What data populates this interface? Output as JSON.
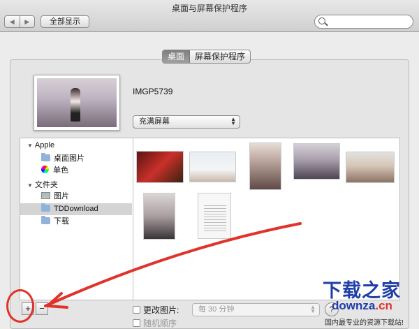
{
  "window": {
    "title": "桌面与屏幕保护程序"
  },
  "toolbar": {
    "back_icon": "◀",
    "forward_icon": "▶",
    "show_all": "全部显示",
    "search_placeholder": ""
  },
  "tabs": [
    {
      "label": "桌面",
      "active": true
    },
    {
      "label": "屏幕保护程序",
      "active": false
    }
  ],
  "preview": {
    "filename": "IMGP5739"
  },
  "fill_mode": {
    "selected": "充满屏幕"
  },
  "sidebar": {
    "groups": [
      {
        "label": "Apple",
        "items": [
          {
            "label": "桌面图片",
            "icon": "folder-icon"
          },
          {
            "label": "单色",
            "icon": "color-wheel-icon"
          }
        ]
      },
      {
        "label": "文件夹",
        "items": [
          {
            "label": "图片",
            "icon": "photos-icon"
          },
          {
            "label": "TDDownload",
            "icon": "folder-icon",
            "selected": true
          },
          {
            "label": "下载",
            "icon": "folder-icon"
          }
        ]
      }
    ]
  },
  "footer": {
    "add_label": "+",
    "remove_label": "−",
    "change_picture": {
      "label": "更改图片:",
      "checked": false
    },
    "interval": "每 30 分钟",
    "random_order": {
      "label": "随机顺序",
      "checked": false
    },
    "help_label": "?"
  },
  "watermark": {
    "title": "下载之家",
    "url_main": "downza",
    "url_tld": ".cn",
    "slogan": "国内最专业的资源下载站!"
  },
  "colors": {
    "annotation_red": "#e0342a",
    "selection_gray": "#d4d4d4",
    "watermark_blue": "#1f3ea8"
  }
}
